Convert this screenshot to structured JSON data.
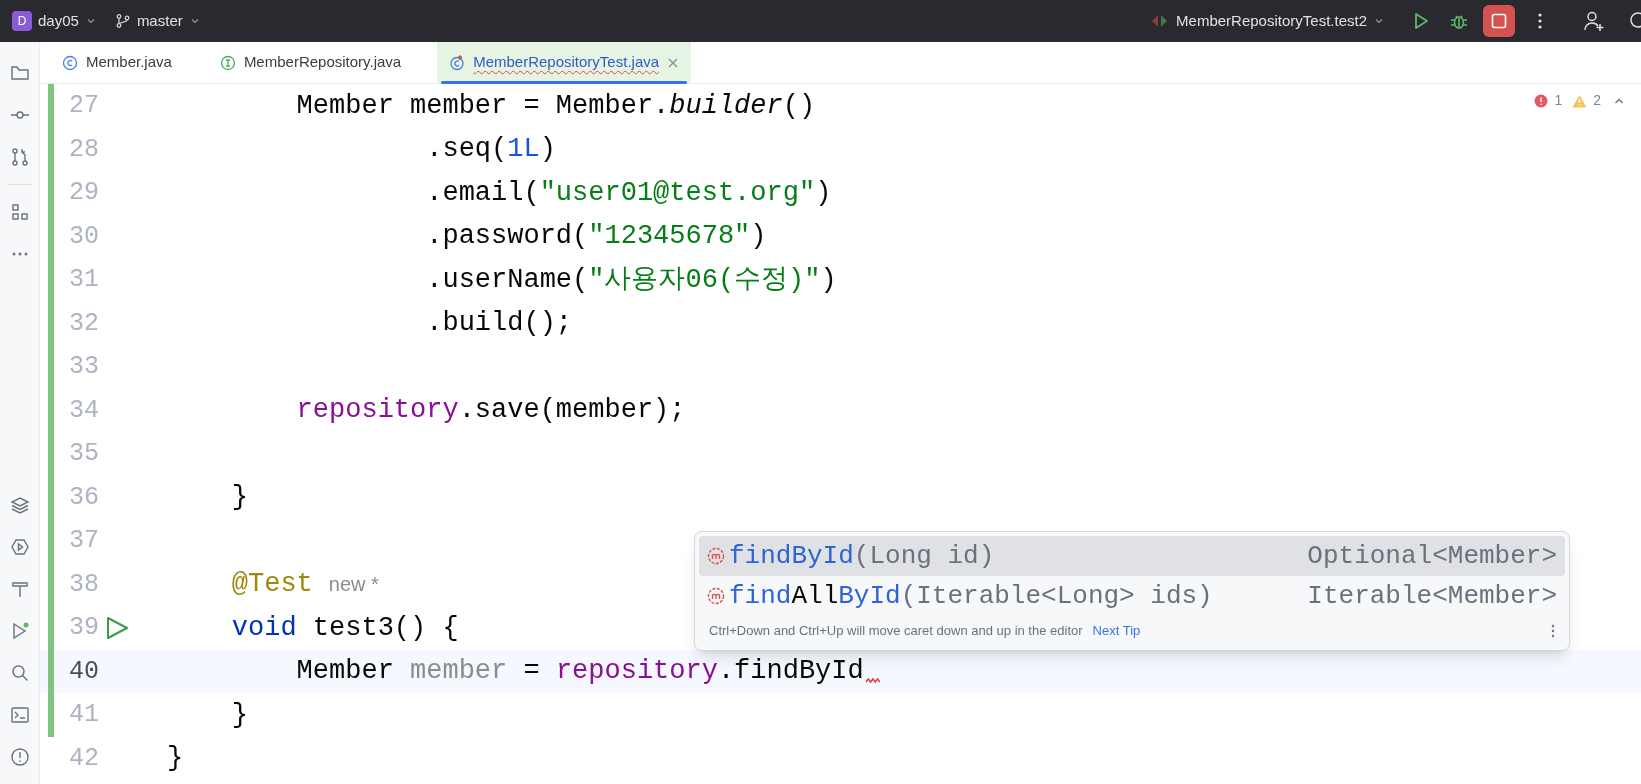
{
  "title_bar": {
    "project_badge": "D",
    "project": "day05",
    "branch": "master",
    "run_config": "MemberRepositoryTest.test2"
  },
  "tabs": [
    {
      "label": "Member.java",
      "kind": "class",
      "selected": false
    },
    {
      "label": "MemberRepository.java",
      "kind": "interface",
      "selected": false
    },
    {
      "label": "MemberRepositoryTest.java",
      "kind": "test",
      "selected": true
    }
  ],
  "inspections": {
    "errors": "1",
    "warnings": "2"
  },
  "lines": [
    {
      "number": "27",
      "changed": true,
      "current": false,
      "run_marker": false,
      "error": false,
      "tokens": [
        {
          "kind": "plain",
          "text": "        Member member = Member."
        },
        {
          "kind": "static",
          "text": "builder"
        },
        {
          "kind": "plain",
          "text": "()"
        }
      ]
    },
    {
      "number": "28",
      "changed": true,
      "current": false,
      "run_marker": false,
      "error": false,
      "tokens": [
        {
          "kind": "plain",
          "text": "                .seq("
        },
        {
          "kind": "number",
          "text": "1L"
        },
        {
          "kind": "plain",
          "text": ")"
        }
      ]
    },
    {
      "number": "29",
      "changed": true,
      "current": false,
      "run_marker": false,
      "error": false,
      "tokens": [
        {
          "kind": "plain",
          "text": "                .email("
        },
        {
          "kind": "string",
          "text": "\"user01@test.org\""
        },
        {
          "kind": "plain",
          "text": ")"
        }
      ]
    },
    {
      "number": "30",
      "changed": true,
      "current": false,
      "run_marker": false,
      "error": false,
      "tokens": [
        {
          "kind": "plain",
          "text": "                .password("
        },
        {
          "kind": "string",
          "text": "\"12345678\""
        },
        {
          "kind": "plain",
          "text": ")"
        }
      ]
    },
    {
      "number": "31",
      "changed": true,
      "current": false,
      "run_marker": false,
      "error": false,
      "tokens": [
        {
          "kind": "plain",
          "text": "                .userName("
        },
        {
          "kind": "string",
          "text": "\"사용자06(수정)\""
        },
        {
          "kind": "plain",
          "text": ")"
        }
      ]
    },
    {
      "number": "32",
      "changed": true,
      "current": false,
      "run_marker": false,
      "error": false,
      "tokens": [
        {
          "kind": "plain",
          "text": "                .build();"
        }
      ]
    },
    {
      "number": "33",
      "changed": true,
      "current": false,
      "run_marker": false,
      "error": false
    },
    {
      "number": "34",
      "changed": true,
      "current": false,
      "run_marker": false,
      "error": false,
      "tokens": [
        {
          "kind": "field",
          "text": "        repository"
        },
        {
          "kind": "plain",
          "text": ".save(member);"
        }
      ]
    },
    {
      "number": "35",
      "changed": true,
      "current": false,
      "run_marker": false,
      "error": false
    },
    {
      "number": "36",
      "changed": true,
      "current": false,
      "run_marker": false,
      "error": false,
      "tokens": [
        {
          "kind": "plain",
          "text": "    }"
        }
      ]
    },
    {
      "number": "37",
      "changed": true,
      "current": false,
      "run_marker": false,
      "error": false
    },
    {
      "number": "38",
      "changed": true,
      "current": false,
      "run_marker": false,
      "error": false,
      "tokens": [
        {
          "kind": "annotation",
          "text": "    @Test"
        },
        {
          "kind": "hint",
          "text": "new *"
        }
      ]
    },
    {
      "number": "39",
      "changed": true,
      "current": false,
      "run_marker": true,
      "error": false,
      "tokens": [
        {
          "kind": "keyword",
          "text": "    void"
        },
        {
          "kind": "plain",
          "text": " test3() {"
        }
      ]
    },
    {
      "number": "40",
      "changed": true,
      "current": true,
      "run_marker": false,
      "error": true,
      "tokens": [
        {
          "kind": "plain",
          "text": "        Member "
        },
        {
          "kind": "unused",
          "text": "member"
        },
        {
          "kind": "plain",
          "text": " = "
        },
        {
          "kind": "field",
          "text": "repository"
        },
        {
          "kind": "plain",
          "text": ".findById"
        }
      ]
    },
    {
      "number": "41",
      "changed": true,
      "current": false,
      "run_marker": false,
      "error": false,
      "tokens": [
        {
          "kind": "plain",
          "text": "    }"
        }
      ]
    },
    {
      "number": "42",
      "changed": false,
      "current": false,
      "run_marker": false,
      "error": false,
      "tokens": [
        {
          "kind": "plain",
          "text": "}"
        }
      ]
    }
  ],
  "completion": {
    "items": [
      {
        "selected": true,
        "name": [
          {
            "text": "findById",
            "matched": true
          }
        ],
        "params": "(Long id)",
        "type": "Optional<Member>"
      },
      {
        "selected": false,
        "name": [
          {
            "text": "find",
            "matched": true
          },
          {
            "text": "All",
            "matched": false
          },
          {
            "text": "ById",
            "matched": true
          }
        ],
        "params": "(Iterable<Long> ids)",
        "type": "Iterable<Member>"
      }
    ],
    "tip": "Ctrl+Down and Ctrl+Up will move caret down and up in the editor",
    "tip_link": "Next Tip"
  }
}
